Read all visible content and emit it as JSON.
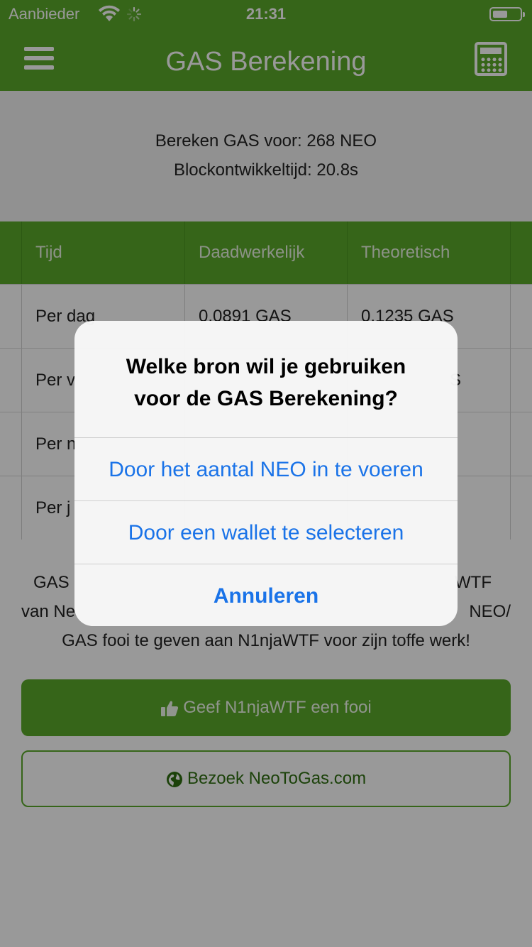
{
  "status_bar": {
    "carrier": "Aanbieder",
    "time": "21:31"
  },
  "header": {
    "title": "GAS Berekening",
    "menu_icon": "hamburger-menu-icon",
    "calculator_icon": "calculator-icon"
  },
  "info": {
    "line1": "Bereken GAS voor: 268 NEO",
    "line2": "Blockontwikkeltijd: 20.8s"
  },
  "table": {
    "headers": [
      "Tijd",
      "Daadwerkelijk",
      "Theoretisch"
    ],
    "rows": [
      [
        "Per dag",
        "0.0891 GAS",
        "0.1235 GAS"
      ],
      [
        "Per v",
        "",
        "S"
      ],
      [
        "Per n",
        "",
        ""
      ],
      [
        "Per j",
        "",
        ""
      ]
    ]
  },
  "footer": {
    "text_line1_left": "GAS",
    "text_line1_right": "WTF",
    "text_line2_left": "van Ne",
    "text_line2_right": "NEO/",
    "text_line3": "GAS fooi te geven aan N1njaWTF voor zijn toffe werk!",
    "tip_button": "Geef N1njaWTF een fooi",
    "tip_icon": "thumbs-up-icon",
    "visit_button": "Bezoek NeoToGas.com",
    "visit_icon": "globe-icon"
  },
  "alert": {
    "title_line1": "Welke bron wil je gebruiken",
    "title_line2": "voor de GAS Berekening?",
    "option1": "Door het aantal NEO in te voeren",
    "option2": "Door een wallet te selecteren",
    "cancel": "Annuleren"
  },
  "colors": {
    "brand_green": "#5aa92a",
    "ios_blue": "#1a73e8"
  }
}
